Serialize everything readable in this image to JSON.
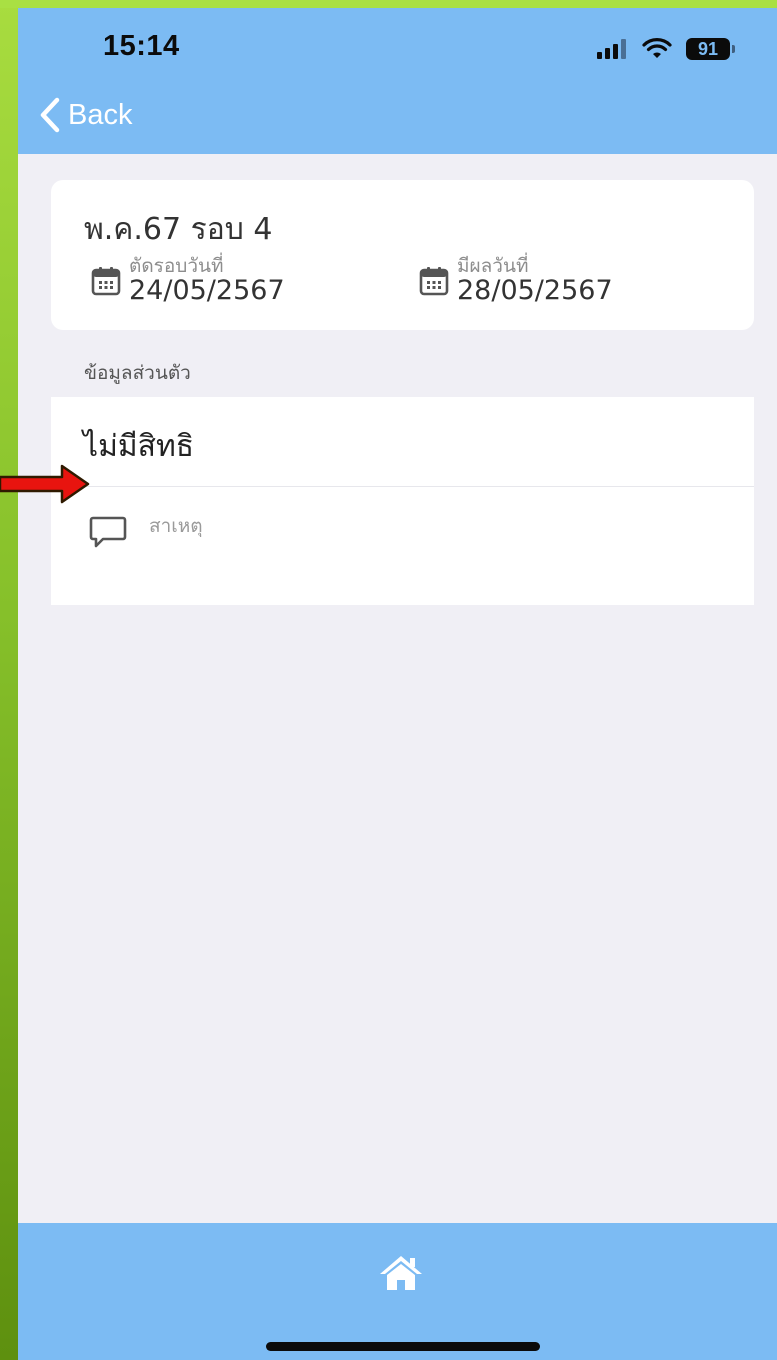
{
  "status_bar": {
    "time": "15:14",
    "battery": "91"
  },
  "nav": {
    "back_label": "Back"
  },
  "round_card": {
    "title": "พ.ค.67 รอบ 4",
    "cut_off": {
      "label": "ตัดรอบวันที่",
      "date": "24/05/2567"
    },
    "result": {
      "label": "มีผลวันที่",
      "date": "28/05/2567"
    }
  },
  "personal_section": {
    "label": "ข้อมูลส่วนตัว",
    "status": "ไม่มีสิทธิ",
    "reason_label": "สาเหตุ"
  },
  "icons": {
    "back": "chevron-left-icon",
    "calendar": "calendar-icon",
    "reason": "chat-bubble-icon",
    "home": "home-icon",
    "annotation": "red-arrow-icon"
  },
  "colors": {
    "header_bg": "#7cbbf3",
    "page_bg": "#f0eff5",
    "card_bg": "#ffffff",
    "arrow_fill": "#e8140f",
    "outer_bg_top": "#a8dc3f",
    "outer_bg_bottom": "#5e900f"
  }
}
